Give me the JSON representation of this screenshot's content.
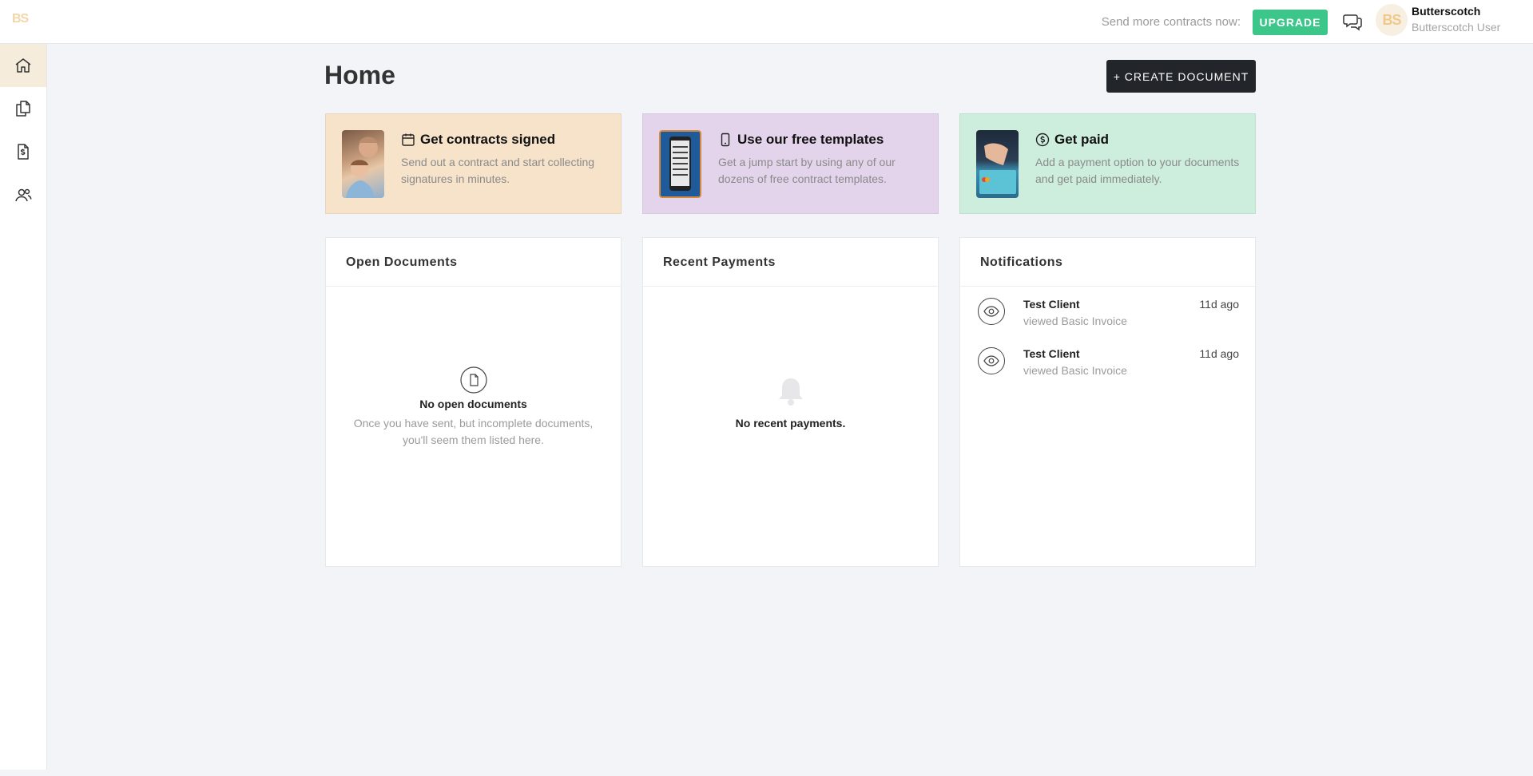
{
  "brand": {
    "logo": "BS"
  },
  "topbar": {
    "promo_text": "Send more contracts now:",
    "upgrade_label": "UPGRADE",
    "avatar_initials": "BS",
    "user_name": "Butterscotch",
    "user_role": "Butterscotch User"
  },
  "sidebar": {
    "items": [
      {
        "icon": "home-icon",
        "active": true
      },
      {
        "icon": "documents-icon",
        "active": false
      },
      {
        "icon": "invoice-icon",
        "active": false
      },
      {
        "icon": "contacts-icon",
        "active": false
      }
    ]
  },
  "page": {
    "title": "Home",
    "create_label": "+ CREATE DOCUMENT"
  },
  "promo_cards": [
    {
      "icon": "calendar-icon",
      "title": "Get contracts signed",
      "description": "Send out a contract and start collecting signatures in minutes.",
      "color": "#f6e3ca"
    },
    {
      "icon": "phone-icon",
      "title": "Use our free templates",
      "description": "Get a jump start by using any of our dozens of free contract templates.",
      "color": "#e3d4ec"
    },
    {
      "icon": "dollar-icon",
      "title": "Get paid",
      "description": "Add a payment option to your documents and get paid immediately.",
      "color": "#cdeedc"
    }
  ],
  "open_documents": {
    "title": "Open Documents",
    "empty_title": "No open documents",
    "empty_desc": "Once you have sent, but incomplete documents, you'll seem them listed here."
  },
  "recent_payments": {
    "title": "Recent Payments",
    "empty_title": "No recent payments."
  },
  "notifications": {
    "title": "Notifications",
    "items": [
      {
        "name": "Test Client",
        "action": "viewed Basic Invoice",
        "time": "11d ago"
      },
      {
        "name": "Test Client",
        "action": "viewed Basic Invoice",
        "time": "11d ago"
      }
    ]
  },
  "colors": {
    "upgrade": "#3cc68a",
    "create_button": "#22252a",
    "sidebar_active": "#f5ecdc",
    "logo": "#f3d6a8"
  }
}
